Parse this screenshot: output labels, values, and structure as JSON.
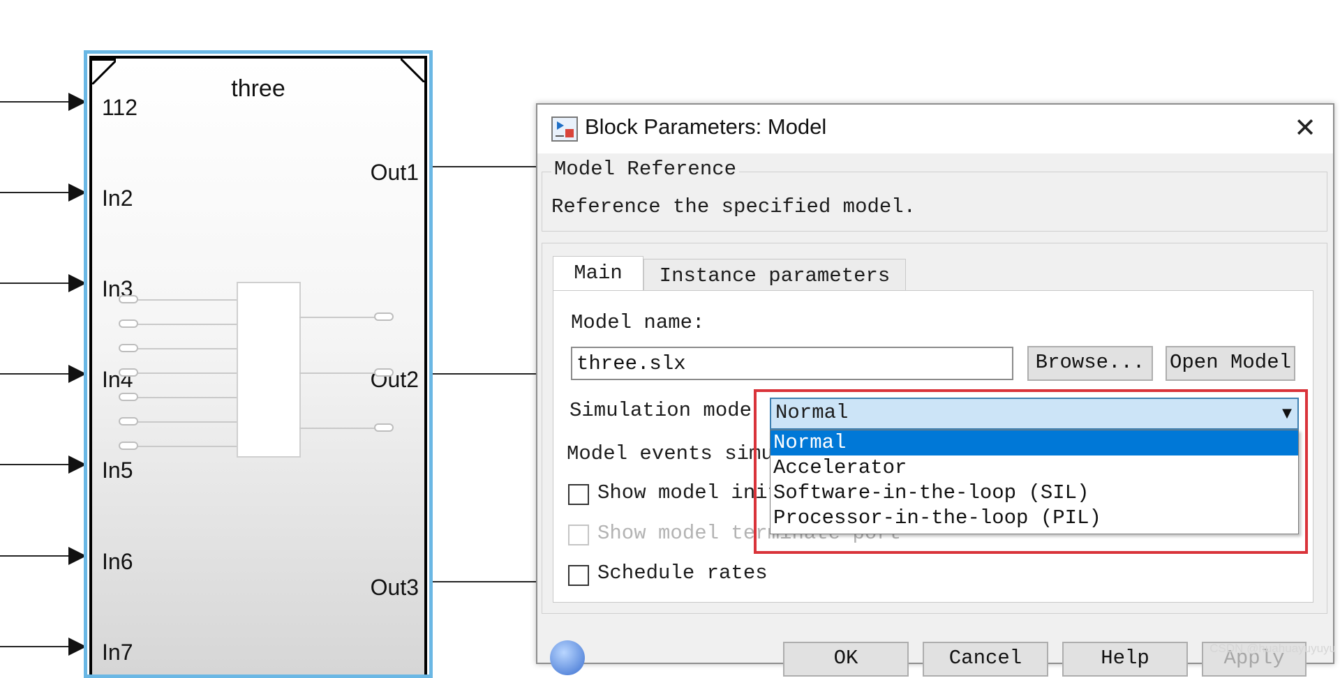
{
  "canvas": {
    "block_name": "three",
    "inports": [
      "112",
      "In2",
      "In3",
      "In4",
      "In5",
      "In6",
      "In7"
    ],
    "outports": [
      "Out1",
      "Out2",
      "Out3"
    ]
  },
  "dialog": {
    "title": "Block Parameters: Model",
    "close_glyph": "✕",
    "group_title": "Model Reference",
    "description": "Reference the specified model.",
    "tabs": [
      {
        "label": "Main",
        "active": true
      },
      {
        "label": "Instance parameters",
        "active": false
      }
    ],
    "model_name_label": "Model name:",
    "model_name_value": "three.slx",
    "browse_label": "Browse...",
    "open_model_label": "Open Model",
    "sim_mode_label": "Simulation mode",
    "sim_mode_value": "Normal",
    "sim_mode_options": [
      "Normal",
      "Accelerator",
      "Software-in-the-loop (SIL)",
      "Processor-in-the-loop (PIL)"
    ],
    "model_events_label": "Model events simu",
    "show_init_label": "Show model init",
    "show_term_label": "Show model terminate port",
    "schedule_label": "Schedule rates",
    "buttons": [
      "OK",
      "Cancel",
      "Help",
      "Apply"
    ],
    "highlight_color": "#d9333a",
    "selected_option_color": "#0078d7"
  },
  "watermark": "CSDN @huahuayuyuyu"
}
